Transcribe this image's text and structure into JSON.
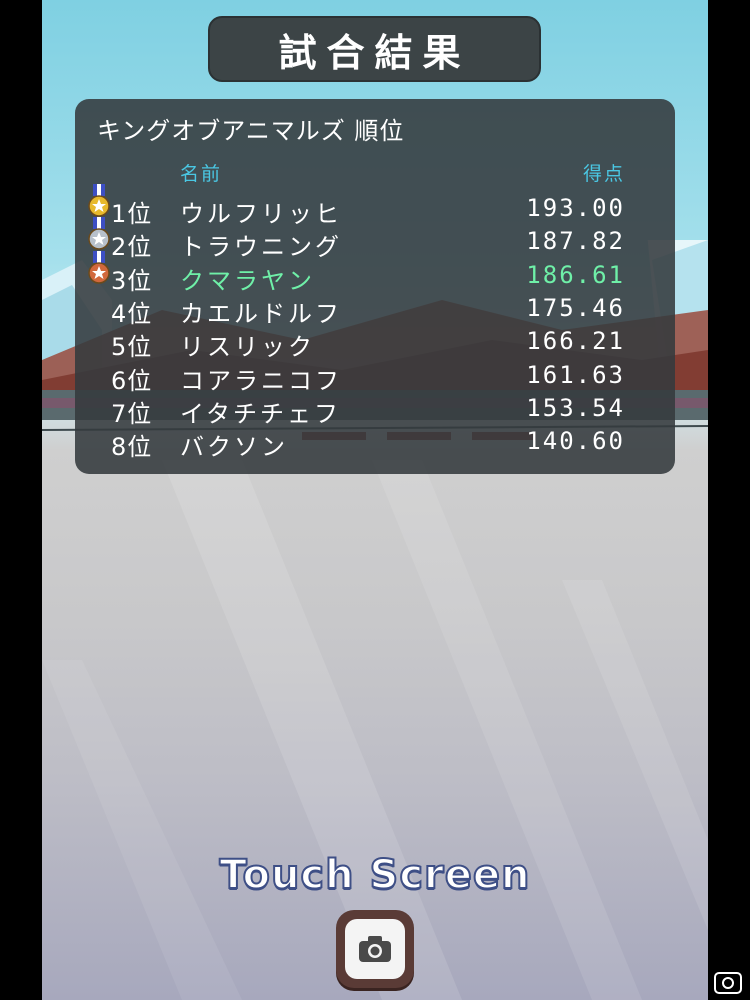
{
  "title": "試合結果",
  "panel": {
    "title": "キングオブアニマルズ 順位",
    "header_name": "名前",
    "header_score": "得点"
  },
  "rows": [
    {
      "rank": "1位",
      "name": "ウルフリッヒ",
      "score": "193.00",
      "medal": "gold",
      "highlight": false
    },
    {
      "rank": "2位",
      "name": "トラウニング",
      "score": "187.82",
      "medal": "silver",
      "highlight": false
    },
    {
      "rank": "3位",
      "name": "クマラヤン",
      "score": "186.61",
      "medal": "bronze",
      "highlight": true
    },
    {
      "rank": "4位",
      "name": "カエルドルフ",
      "score": "175.46",
      "medal": null,
      "highlight": false
    },
    {
      "rank": "5位",
      "name": "リスリック",
      "score": "166.21",
      "medal": null,
      "highlight": false
    },
    {
      "rank": "6位",
      "name": "コアラニコフ",
      "score": "161.63",
      "medal": null,
      "highlight": false
    },
    {
      "rank": "7位",
      "name": "イタチチェフ",
      "score": "153.54",
      "medal": null,
      "highlight": false
    },
    {
      "rank": "8位",
      "name": "バクソン",
      "score": "140.60",
      "medal": null,
      "highlight": false
    }
  ],
  "touch_prompt": "Touch Screen",
  "camera_icon": "camera-icon",
  "colors": {
    "panel_bg": "#343a3e",
    "header_accent": "#4ac7e3",
    "highlight_green": "#6ff0a8",
    "title_bg": "#3c4446",
    "gold": "#e7b92c",
    "silver": "#b7c0cb",
    "bronze": "#d1683c"
  }
}
